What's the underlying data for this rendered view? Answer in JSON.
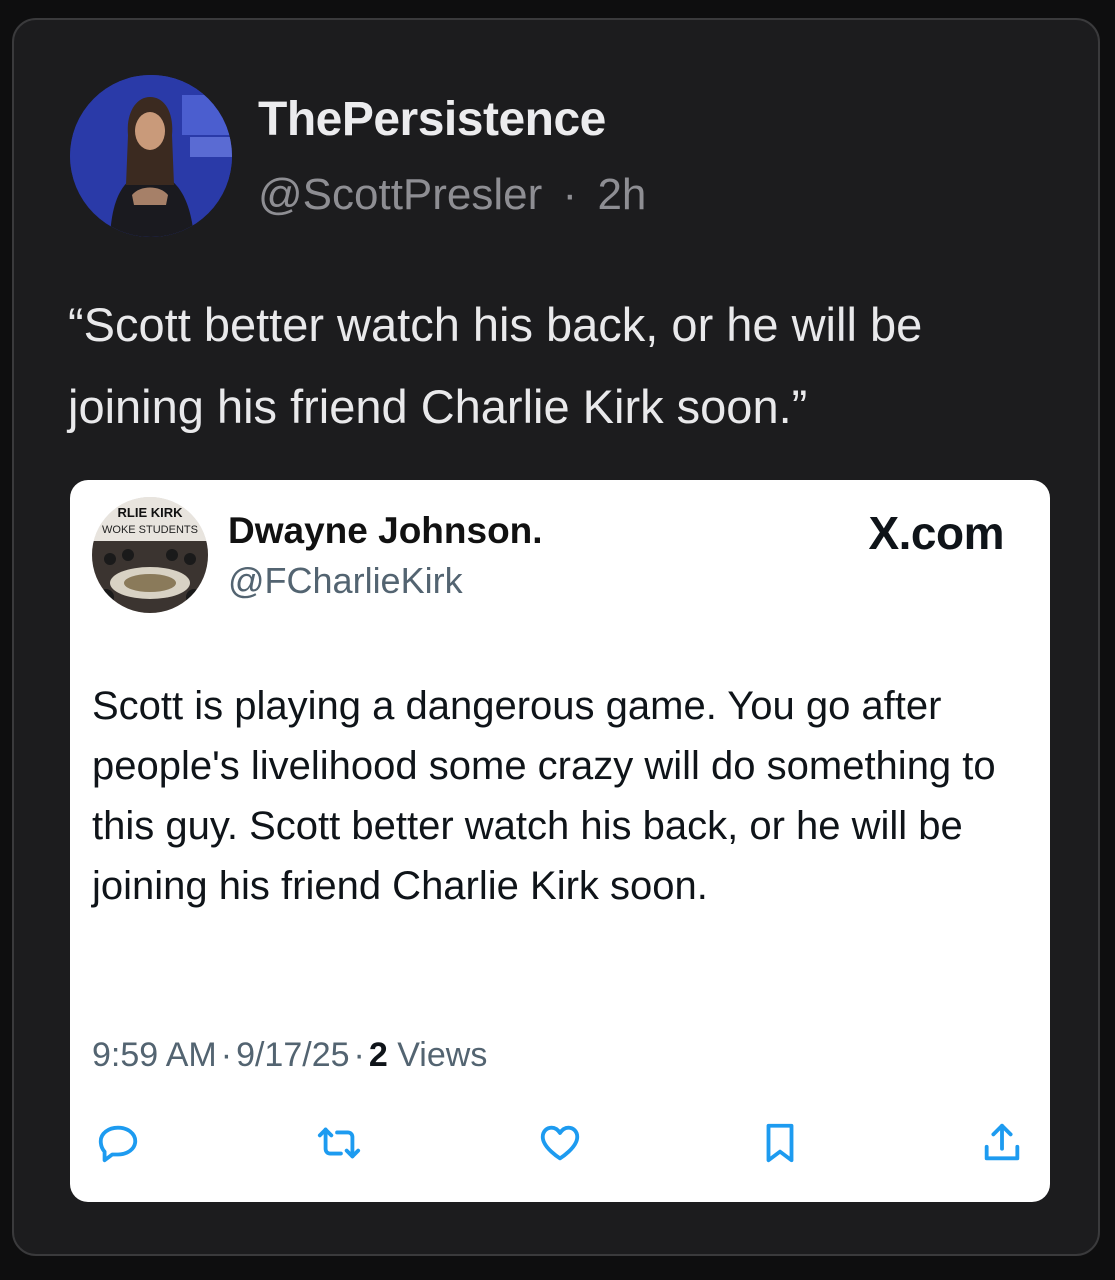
{
  "tweet": {
    "author_name": "ThePersistence",
    "author_handle": "@ScottPresler",
    "separator": "·",
    "time_ago": "2h",
    "text": "“Scott better watch his back, or he will be joining his friend Charlie Kirk soon.”"
  },
  "quoted": {
    "avatar_caption_line1": "RLIE KIRK",
    "avatar_caption_line2": "WOKE STUDENTS",
    "author_name": "Dwayne Johnson.",
    "author_handle": "@FCharlieKirk",
    "brand": "X.com",
    "text": "Scott is playing a dangerous game. You go after people's livelihood some crazy will do something to this guy. Scott better watch his back, or he will be joining his friend Charlie Kirk soon.",
    "time": "9:59 AM",
    "date": "9/17/25",
    "separator": "·",
    "views_count": "2",
    "views_label": "Views",
    "actions": [
      "reply-icon",
      "retweet-icon",
      "like-icon",
      "bookmark-icon",
      "share-icon"
    ]
  },
  "colors": {
    "page_background": "#0e0e0f",
    "card_background": "#1c1c1e",
    "card_border": "#3a3a3c",
    "primary_text": "#e9e9eb",
    "secondary_text": "#8e8e93",
    "quote_background": "#ffffff",
    "quote_secondary": "#536471",
    "icon_color": "#1d9bf0"
  }
}
